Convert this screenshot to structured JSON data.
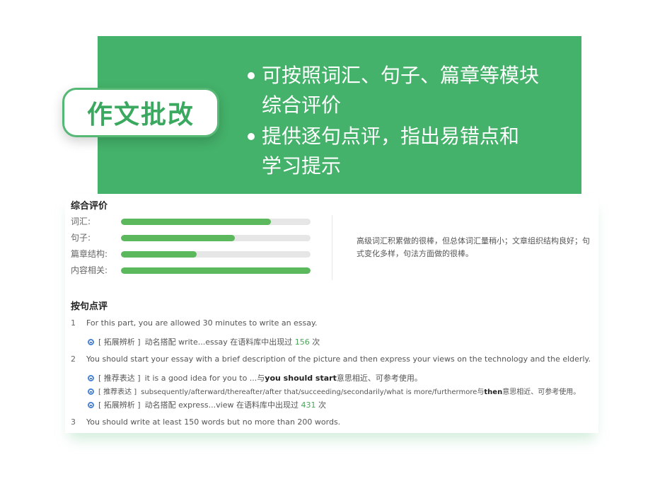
{
  "banner": {
    "badge": "作文批改",
    "bullets": [
      {
        "line1": "可按照词汇、句子、篇章等模块",
        "line2": "综合评价"
      },
      {
        "line1": "提供逐句点评，指出易错点和",
        "line2": "学习提示"
      }
    ],
    "color": "#44b26a"
  },
  "overall": {
    "title": "综合评价",
    "scores": [
      {
        "label": "词汇:",
        "value": 0.79
      },
      {
        "label": "句子:",
        "value": 0.6
      },
      {
        "label": "篇章结构:",
        "value": 0.4
      },
      {
        "label": "内容相关:",
        "value": 1.0
      }
    ],
    "summary": "高级词汇积累做的很棒，但总体词汇量稍小；文章组织结构良好；句式变化多样，句法方面做的很棒。"
  },
  "sentences": {
    "title": "按句点评",
    "items": [
      {
        "num": "1",
        "text": "For this part, you are allowed 30 minutes to write an essay.",
        "notes": [
          {
            "tag": "[ 拓展辨析 ]",
            "pre": "动名搭配 write...essay 在语料库中出现过",
            "count": "156",
            "post": "次"
          }
        ]
      },
      {
        "num": "2",
        "text": "You should start your essay with a brief description of the picture and then express your views on the technology and the elderly.",
        "notes": [
          {
            "tag": "[ 推荐表达 ]",
            "pre": "it is a good idea for you to ...与",
            "bold": "you should start",
            "post": "意思相近、可参考使用。"
          },
          {
            "tag": "[ 推荐表达 ]",
            "pre": "subsequently/afterward/thereafter/after that/succeeding/secondarily/what is more/furthermore与",
            "bold": "then",
            "post": "意思相近、可参考使用。"
          },
          {
            "tag": "[ 拓展辨析 ]",
            "pre": "动名搭配 express...view 在语料库中出现过",
            "count": "431",
            "post": "次"
          }
        ]
      },
      {
        "num": "3",
        "text": "You should write at least 150 words but no more than 200 words.",
        "notes": []
      }
    ]
  }
}
